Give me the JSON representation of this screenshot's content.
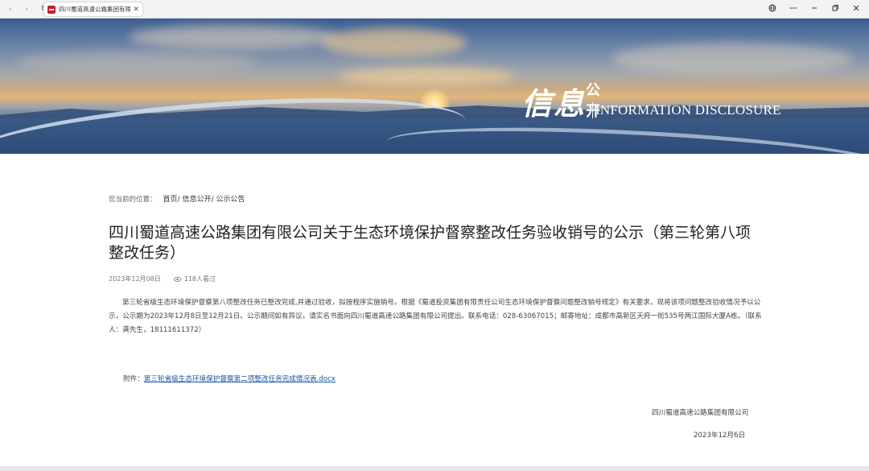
{
  "browser": {
    "tab_title": "四川蜀道高速公路集团有限公司",
    "tab_close": "✕",
    "nav_back": "‹",
    "nav_forward": "›",
    "reload": "↻",
    "icons": [
      "globe-icon",
      "more-icon",
      "minimize-icon",
      "restore-icon",
      "close-icon"
    ]
  },
  "banner": {
    "title_cn_big": "信息",
    "title_cn_small": "公开",
    "title_en": "INFORMATION DISCLOSURE"
  },
  "breadcrumb": {
    "prefix": "您当前的位置：",
    "items": [
      "首页/",
      "信息公开/",
      "公示公告"
    ]
  },
  "article": {
    "title": "四川蜀道高速公路集团有限公司关于生态环境保护督察整改任务验收销号的公示（第三轮第八项整改任务）",
    "date": "2023年12月08日",
    "views": "118人看过",
    "body": "第三轮省级生态环境保护督察第八项整改任务已整改完成,并通过验收，拟按程序实施销号。根据《蜀道投资集团有限责任公司生态环境保护督察问题整改销号规定》有关要求，现将该项问题整改验收情况予以公示，公示期为2023年12月8日至12月21日。公示期间如有异议，请实名书面向四川蜀道高速公路集团有限公司提出。联系电话：028-63067015；邮寄地址：成都市高新区天府一街535号两江国际大厦A栋。（联系人：龚先生，18111611372）",
    "attachment_label": "附件：",
    "attachment_link": "第三轮省级生态环境保护督察第二项整改任务完成情况表.docx",
    "signature": "四川蜀道高速公路集团有限公司",
    "signature_date": "2023年12月6日"
  }
}
